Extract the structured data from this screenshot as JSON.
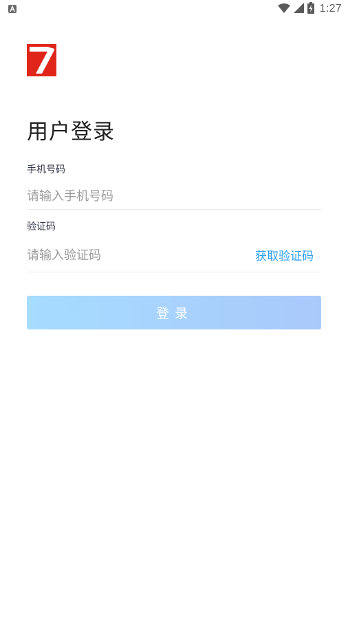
{
  "status_bar": {
    "time": "1:27",
    "icons": [
      "notification-a-icon",
      "wifi-icon",
      "cellular-signal-icon",
      "battery-charging-icon"
    ]
  },
  "logo": {
    "name": "app-logo",
    "colors": {
      "red": "#e0261b",
      "white": "#ffffff"
    }
  },
  "title": "用户登录",
  "form": {
    "phone": {
      "label": "手机号码",
      "placeholder": "请输入手机号码",
      "value": ""
    },
    "code": {
      "label": "验证码",
      "placeholder": "请输入验证码",
      "value": "",
      "get_code_label": "获取验证码"
    },
    "submit_label": "登录"
  },
  "colors": {
    "accent": "#2f9ef0",
    "button_gradient_start": "#a6dcff",
    "button_gradient_end": "#a9c9fb",
    "divider": "#ececec"
  }
}
